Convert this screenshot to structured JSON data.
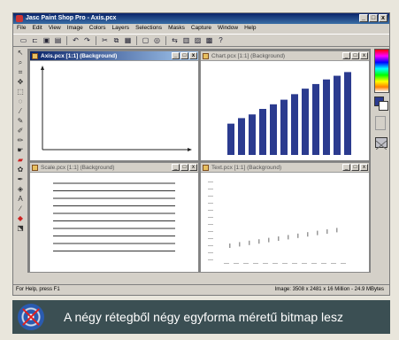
{
  "window": {
    "title": "Jasc Paint Shop Pro - Axis.pcx",
    "minimize": "_",
    "maximize": "□",
    "close": "x"
  },
  "menu": [
    "File",
    "Edit",
    "View",
    "Image",
    "Colors",
    "Layers",
    "Selections",
    "Masks",
    "Capture",
    "Window",
    "Help"
  ],
  "toolbar_icons": [
    "new-icon",
    "open-icon",
    "save-icon",
    "print-icon",
    "undo-icon",
    "redo-icon",
    "cut-icon",
    "copy-icon",
    "paste-icon",
    "screen-icon",
    "browse-icon",
    "toggle-icon",
    "histogram-icon",
    "image-icon",
    "layers-icon",
    "help-icon"
  ],
  "tool_icons": [
    "select-arrow-icon",
    "zoom-icon",
    "crop-icon",
    "mover-icon",
    "selection-icon",
    "lasso-icon",
    "dropper-icon",
    "paintbrush-icon",
    "clone-icon",
    "color-replacer-icon",
    "retouch-icon",
    "eraser-icon",
    "picture-tube-icon",
    "airbrush-icon",
    "flood-fill-icon",
    "text-icon",
    "draw-icon",
    "preset-shapes-icon",
    "object-selector-icon"
  ],
  "documents": [
    {
      "title": "Axis.pcx [1:1] (Background)",
      "active": true
    },
    {
      "title": "Chart.pcx [1:1] (Background)",
      "active": false
    },
    {
      "title": "Scale.pcx [1:1] (Background)",
      "active": false
    },
    {
      "title": "Text.pcx [1:1] (Background)",
      "active": false
    }
  ],
  "doc_buttons": {
    "minimize": "_",
    "maximize": "□",
    "close": "x"
  },
  "chart_bars": [
    0.34,
    0.4,
    0.44,
    0.5,
    0.55,
    0.6,
    0.66,
    0.72,
    0.77,
    0.82,
    0.86,
    0.9
  ],
  "colors": {
    "title_active": "#0a246a",
    "bar": "#2b3b8f",
    "caption_bg": "#3b4f53"
  },
  "status": {
    "left": "For Help, press F1",
    "right": "Image:  3508 x 2481 x 16 Million - 24.9 MBytes"
  },
  "caption": {
    "text": "A négy rétegből négy egyforma méretű bitmap lesz"
  }
}
